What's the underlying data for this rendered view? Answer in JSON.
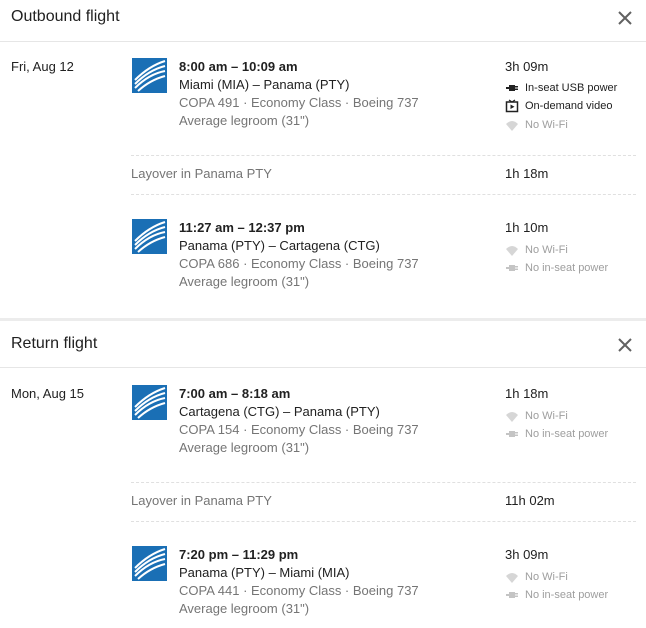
{
  "outbound": {
    "title": "Outbound flight",
    "date": "Fri, Aug 12",
    "leg1": {
      "time": "8:00 am – 10:09 am",
      "route": "Miami (MIA) – Panama (PTY)",
      "info": "COPA 491 · Economy Class · Boeing 737",
      "legroom": "Average legroom (31\")",
      "duration": "3h 09m",
      "amenities": [
        "In-seat USB power",
        "On-demand video",
        "No Wi-Fi"
      ]
    },
    "layover": {
      "label": "Layover in Panama PTY",
      "duration": "1h 18m"
    },
    "leg2": {
      "time": "11:27 am – 12:37 pm",
      "route": "Panama (PTY) – Cartagena (CTG)",
      "info": "COPA 686 · Economy Class · Boeing 737",
      "legroom": "Average legroom (31\")",
      "duration": "1h 10m",
      "amenities": [
        "No Wi-Fi",
        "No in-seat power"
      ]
    }
  },
  "return": {
    "title": "Return flight",
    "date": "Mon, Aug 15",
    "leg1": {
      "time": "7:00 am – 8:18 am",
      "route": "Cartagena (CTG) – Panama (PTY)",
      "info": "COPA 154 · Economy Class · Boeing 737",
      "legroom": "Average legroom (31\")",
      "duration": "1h 18m",
      "amenities": [
        "No Wi-Fi",
        "No in-seat power"
      ]
    },
    "layover": {
      "label": "Layover in Panama PTY",
      "duration": "11h 02m"
    },
    "leg2": {
      "time": "7:20 pm – 11:29 pm",
      "route": "Panama (PTY) – Miami (MIA)",
      "info": "COPA 441 · Economy Class · Boeing 737",
      "legroom": "Average legroom (31\")",
      "duration": "3h 09m",
      "amenities": [
        "No Wi-Fi",
        "No in-seat power"
      ]
    }
  },
  "icons": {
    "close": "close-icon",
    "usb_power": "power-plug-icon",
    "video": "video-icon",
    "wifi_off": "wifi-icon",
    "power_off": "power-plug-icon",
    "airline_logo": "copa-airlines-logo"
  },
  "colors": {
    "logo_blue": "#1a6fb5",
    "text": "#212121",
    "muted": "#757575",
    "disabled": "#9e9e9e"
  }
}
